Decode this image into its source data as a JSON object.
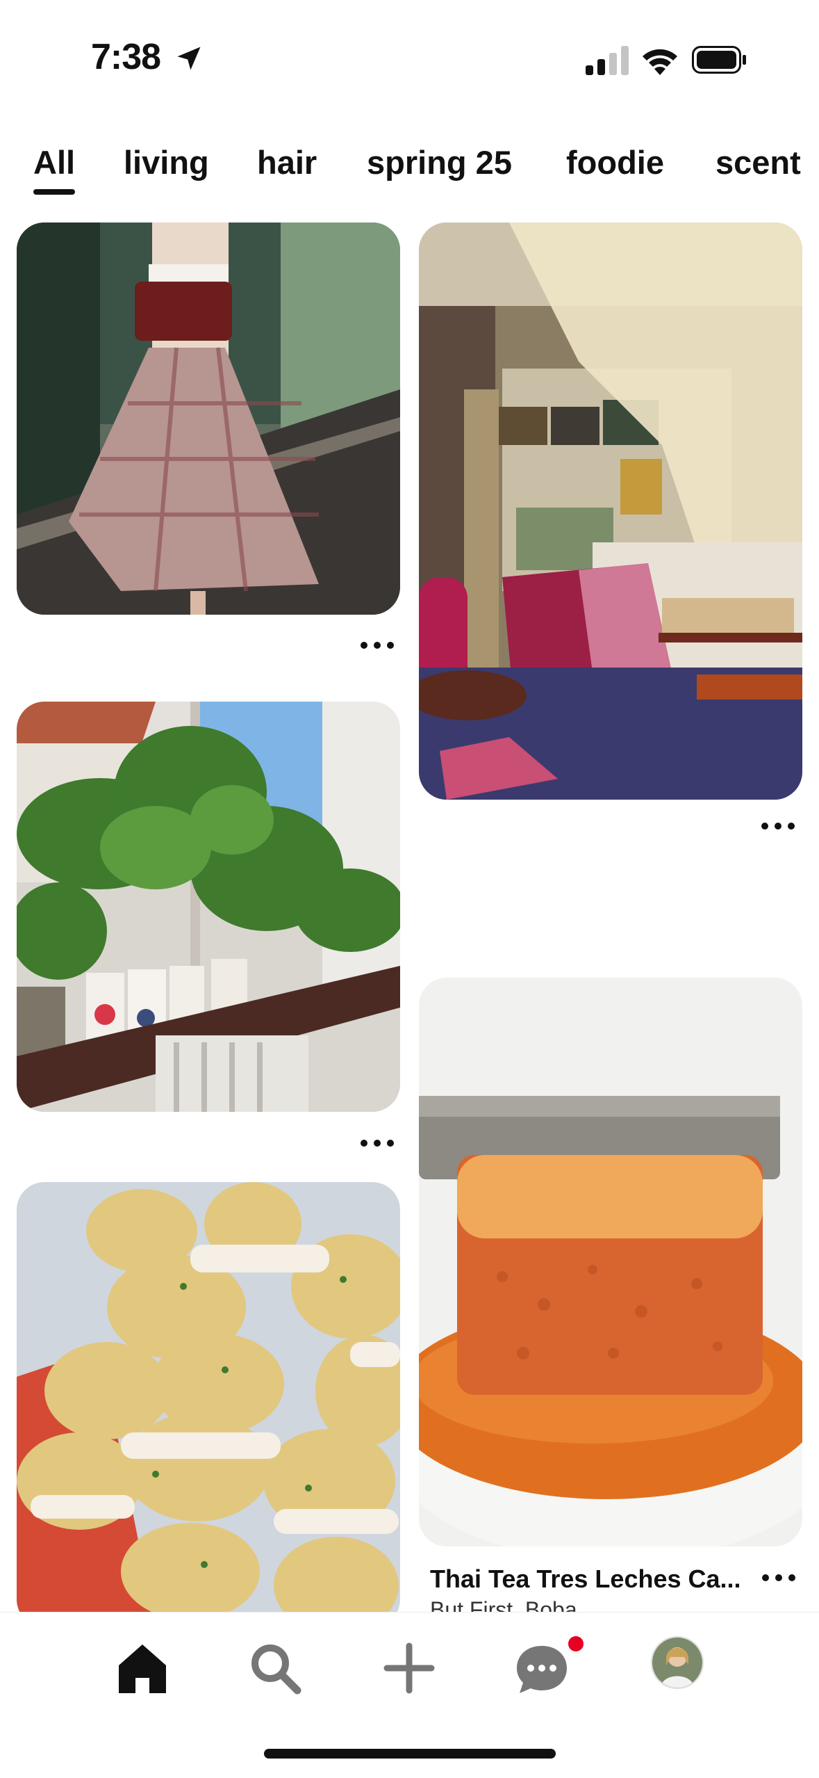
{
  "status_bar": {
    "time": "7:38",
    "icons": [
      "location-arrow-icon",
      "cellular-signal-icon",
      "wifi-icon",
      "battery-icon"
    ]
  },
  "tabs": [
    {
      "label": "All",
      "selected": true
    },
    {
      "label": "living",
      "selected": false
    },
    {
      "label": "hair",
      "selected": false
    },
    {
      "label": "spring 25",
      "selected": false
    },
    {
      "label": "foodie",
      "selected": false
    },
    {
      "label": "scent",
      "selected": false
    }
  ],
  "pins": [
    {
      "name": "plaid-skirt-pin",
      "column": "left"
    },
    {
      "name": "canopy-bedroom-pin",
      "column": "right"
    },
    {
      "name": "tomato-seedlings-pin",
      "column": "left"
    },
    {
      "name": "thai-tea-cake-pin",
      "column": "right",
      "title": "Thai Tea Tres Leches Ca...",
      "subtitle": "But First, Boba"
    },
    {
      "name": "sandwich-cookies-pin",
      "column": "left"
    }
  ],
  "bottom_nav": {
    "items": [
      "home-icon",
      "search-icon",
      "create-plus-icon",
      "messages-icon",
      "profile-avatar"
    ],
    "selected": "home-icon",
    "has_notification": true
  },
  "colors": {
    "accent": "#e60023",
    "text": "#111111"
  }
}
